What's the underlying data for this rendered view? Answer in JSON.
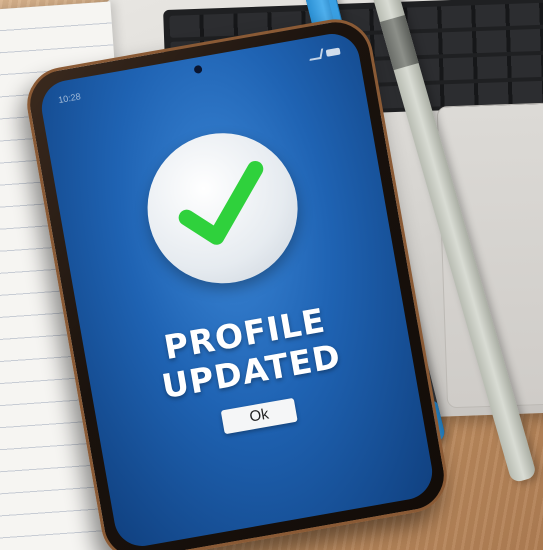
{
  "status_bar": {
    "time": "10:28"
  },
  "dialog": {
    "icon": "checkmark-icon",
    "headline_line1": "PROFILE",
    "headline_line2": "UPDATED",
    "button_label": "Ok"
  },
  "colors": {
    "screen_blue": "#1f63b3",
    "check_green": "#2fd13c",
    "button_bg": "#f5f6f7"
  }
}
